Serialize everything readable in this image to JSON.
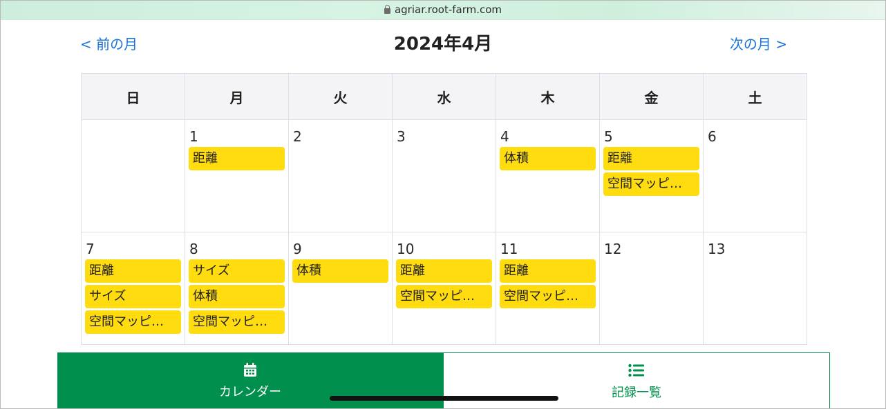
{
  "browser": {
    "url": "agriar.root-farm.com"
  },
  "header": {
    "prev_label": "< 前の月",
    "next_label": "次の月 >",
    "title": "2024年4月"
  },
  "weekdays": [
    "日",
    "月",
    "火",
    "水",
    "木",
    "金",
    "土"
  ],
  "weeks": [
    [
      {
        "day": "",
        "events": []
      },
      {
        "day": "1",
        "events": [
          "距離"
        ]
      },
      {
        "day": "2",
        "events": []
      },
      {
        "day": "3",
        "events": []
      },
      {
        "day": "4",
        "events": [
          "体積"
        ]
      },
      {
        "day": "5",
        "events": [
          "距離",
          "空間マッピ…"
        ]
      },
      {
        "day": "6",
        "events": []
      }
    ],
    [
      {
        "day": "7",
        "events": [
          "距離",
          "サイズ",
          "空間マッピ…"
        ]
      },
      {
        "day": "8",
        "events": [
          "サイズ",
          "体積",
          "空間マッピ…"
        ]
      },
      {
        "day": "9",
        "events": [
          "体積"
        ]
      },
      {
        "day": "10",
        "events": [
          "距離",
          "空間マッピ…"
        ]
      },
      {
        "day": "11",
        "events": [
          "距離",
          "空間マッピ…"
        ]
      },
      {
        "day": "12",
        "events": []
      },
      {
        "day": "13",
        "events": []
      }
    ]
  ],
  "bottom_nav": {
    "calendar_label": "カレンダー",
    "records_label": "記録一覧",
    "calendar_icon": "calendar-icon",
    "records_icon": "list-icon"
  },
  "colors": {
    "accent_green": "#008f4c",
    "event_yellow": "#ffdc0f",
    "link_blue": "#1a73d9"
  }
}
